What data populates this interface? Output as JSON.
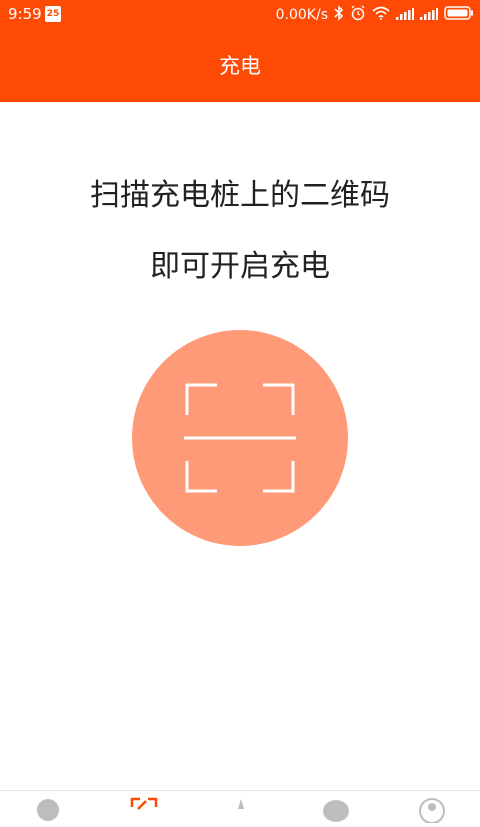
{
  "status_bar": {
    "time": "9:59",
    "calendar_day": "25",
    "network_speed": "0.00K/s"
  },
  "app_bar": {
    "title": "充电"
  },
  "main": {
    "instruction_line1": "扫描充电桩上的二维码",
    "instruction_line2": "即可开启充电",
    "scan_button_color": "#ff9a78"
  },
  "colors": {
    "brand": "#ff4a05",
    "text": "#222222"
  },
  "tab_bar": {
    "tabs": [
      {
        "icon": "map-icon"
      },
      {
        "icon": "scan-icon",
        "active": true
      },
      {
        "icon": "discover-icon"
      },
      {
        "icon": "message-icon"
      },
      {
        "icon": "profile-icon"
      }
    ]
  }
}
